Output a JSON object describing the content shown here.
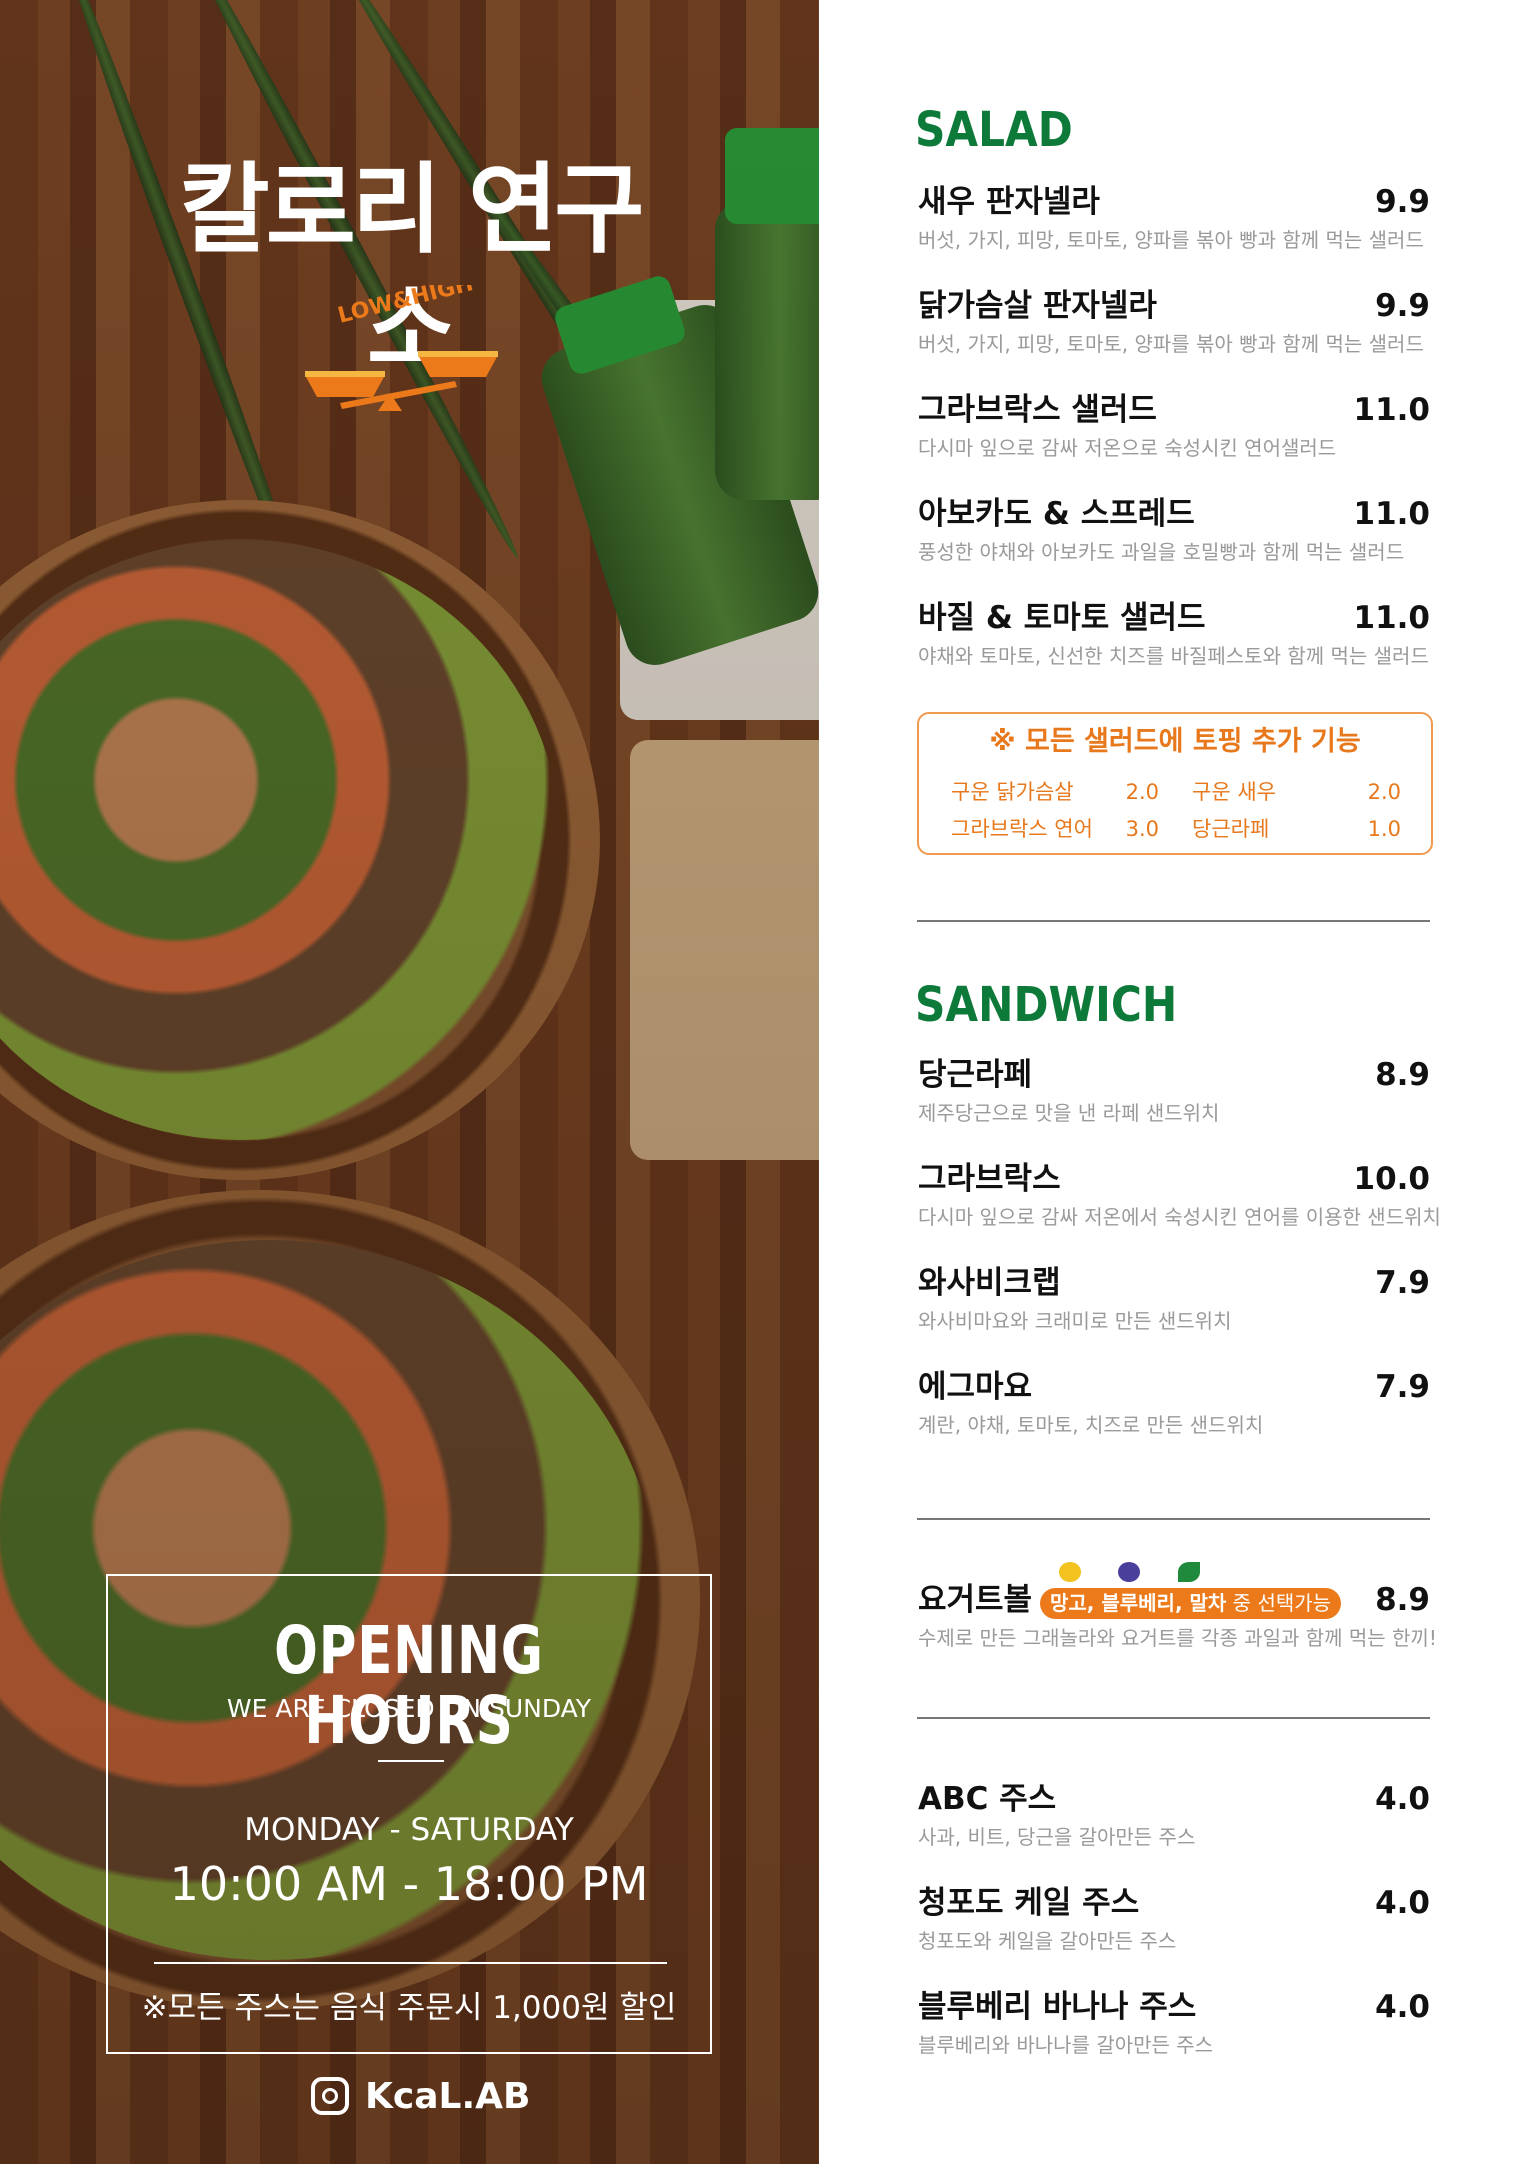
{
  "brand": {
    "title": "칼로리 연구소",
    "logo_text": "LOW&HIGH",
    "instagram": "KcaL.AB"
  },
  "hours": {
    "heading": "OPENING HOURS",
    "closed_note": "WE ARE CLOSED ON SUNDAY",
    "days": "MONDAY - SATURDAY",
    "time": "10:00 AM - 18:00 PM",
    "discount": "※모든 주스는 음식 주문시 1,000원 할인"
  },
  "colors": {
    "section_heading": "#0d7a3a",
    "accent": "#ec7a1a"
  },
  "salad": {
    "heading": "SALAD",
    "items": [
      {
        "name": "새우 판자넬라",
        "price": "9.9",
        "desc": "버섯, 가지, 피망, 토마토, 양파를 볶아 빵과 함께 먹는 샐러드"
      },
      {
        "name": "닭가슴살 판자넬라",
        "price": "9.9",
        "desc": "버섯, 가지, 피망, 토마토, 양파를 볶아 빵과 함께 먹는 샐러드"
      },
      {
        "name": "그라브락스 샐러드",
        "price": "11.0",
        "desc": "다시마 잎으로 감싸 저온으로 숙성시킨 연어샐러드"
      },
      {
        "name": "아보카도 & 스프레드",
        "price": "11.0",
        "desc": "풍성한 야채와 아보카도 과일을 호밀빵과 함께 먹는 샐러드"
      },
      {
        "name": "바질 & 토마토 샐러드",
        "price": "11.0",
        "desc": "야채와 토마토, 신선한 치즈를 바질페스토와 함께 먹는 샐러드"
      }
    ]
  },
  "toppings": {
    "title": "※ 모든 샐러드에 토핑 추가 기능",
    "items": [
      {
        "name": "구운 닭가슴살",
        "price": "2.0"
      },
      {
        "name": "구운 새우",
        "price": "2.0"
      },
      {
        "name": "그라브락스 연어",
        "price": "3.0"
      },
      {
        "name": "당근라페",
        "price": "1.0"
      }
    ]
  },
  "sandwich": {
    "heading": "SANDWICH",
    "items": [
      {
        "name": "당근라페",
        "price": "8.9",
        "desc": "제주당근으로 맛을 낸 라페 샌드위치"
      },
      {
        "name": "그라브락스",
        "price": "10.0",
        "desc": "다시마 잎으로 감싸 저온에서 숙성시킨 연어를 이용한 샌드위치"
      },
      {
        "name": "와사비크랩",
        "price": "7.9",
        "desc": "와사비마요와 크래미로 만든 샌드위치"
      },
      {
        "name": "에그마요",
        "price": "7.9",
        "desc": "계란, 야채, 토마토, 치즈로 만든 샌드위치"
      }
    ]
  },
  "yogurt": {
    "name": "요거트볼",
    "badge_options": "망고, 블루베리, 말차",
    "badge_suffix": " 중 선택가능",
    "price": "8.9",
    "desc": "수제로 만든 그래놀라와 요거트를 각종 과일과 함께 먹는 한끼!",
    "icons": [
      "mango-icon",
      "blueberry-icon",
      "matcha-leaf-icon"
    ]
  },
  "juice": {
    "items": [
      {
        "name": "ABC 주스",
        "price": "4.0",
        "desc": "사과, 비트, 당근을 갈아만든 주스"
      },
      {
        "name": "청포도 케일 주스",
        "price": "4.0",
        "desc": "청포도와 케일을 갈아만든 주스"
      },
      {
        "name": "블루베리 바나나 주스",
        "price": "4.0",
        "desc": "블루베리와 바나나를 갈아만든 주스"
      }
    ]
  }
}
